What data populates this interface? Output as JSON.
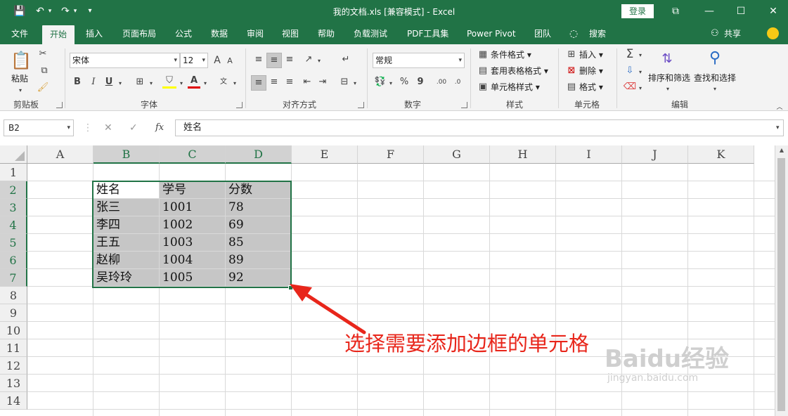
{
  "titlebar": {
    "title": "我的文档.xls  [兼容模式]  -  Excel",
    "login_label": "登录",
    "qat": {
      "save": "💾",
      "undo": "↶",
      "redo": "↷",
      "customize": "▾"
    },
    "window": {
      "ribbon_display": "⧉",
      "minimize": "—",
      "maximize": "☐",
      "close": "✕"
    }
  },
  "tabs": [
    "文件",
    "开始",
    "插入",
    "页面布局",
    "公式",
    "数据",
    "审阅",
    "视图",
    "帮助",
    "负载测试",
    "PDF工具集",
    "Power Pivot",
    "团队",
    "搜索"
  ],
  "share_label": "共享",
  "ribbon": {
    "clipboard": {
      "paste": "粘贴",
      "label": "剪贴板"
    },
    "font": {
      "name": "宋体",
      "size": "12",
      "bold": "B",
      "italic": "I",
      "underline": "U",
      "grow": "A",
      "shrink": "A",
      "font_color": "A",
      "label": "字体"
    },
    "alignment": {
      "label": "对齐方式"
    },
    "number": {
      "format": "常规",
      "percent": "%",
      "comma": "9",
      "label": "数字"
    },
    "styles": {
      "conditional": "条件格式",
      "table": "套用表格格式",
      "cell": "单元格样式",
      "label": "样式"
    },
    "cells": {
      "insert": "插入",
      "delete": "删除",
      "format": "格式",
      "label": "单元格"
    },
    "editing": {
      "sort": "排序和筛选",
      "find": "查找和选择",
      "label": "编辑"
    }
  },
  "formula_bar": {
    "name_box": "B2",
    "cancel": "✕",
    "enter": "✓",
    "fx": "fx",
    "content": "姓名"
  },
  "columns": [
    "A",
    "B",
    "C",
    "D",
    "E",
    "F",
    "G",
    "H",
    "I",
    "J",
    "K"
  ],
  "rows": [
    "1",
    "2",
    "3",
    "4",
    "5",
    "6",
    "7",
    "8",
    "9",
    "10",
    "11",
    "12",
    "13",
    "14"
  ],
  "sheet": {
    "header": [
      "姓名",
      "学号",
      "分数"
    ],
    "records": [
      [
        "张三",
        "1001",
        "78"
      ],
      [
        "李四",
        "1002",
        "69"
      ],
      [
        "王五",
        "1003",
        "85"
      ],
      [
        "赵柳",
        "1004",
        "89"
      ],
      [
        "吴玲玲",
        "1005",
        "92"
      ]
    ]
  },
  "annotation": "选择需要添加边框的单元格",
  "watermark": {
    "brand": "Baidu经验",
    "url": "jingyan.baidu.com"
  },
  "colors": {
    "excel_green": "#217346",
    "selection_fill": "#c6c6c6",
    "annotation_red": "#e8261b"
  }
}
